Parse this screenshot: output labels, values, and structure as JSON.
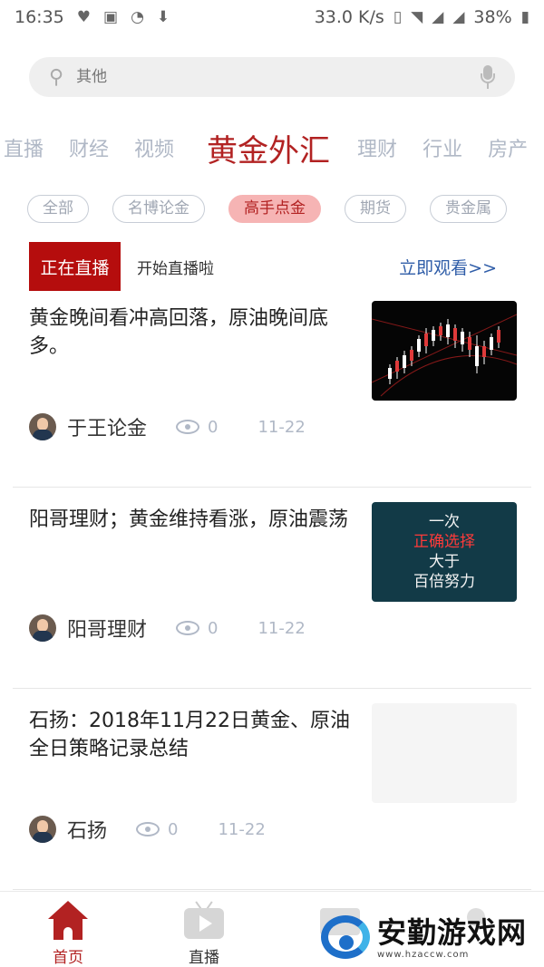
{
  "status_bar": {
    "time": "16:35",
    "speed": "33.0 K/s",
    "battery": "38%"
  },
  "search": {
    "placeholder": "其他"
  },
  "channels": [
    {
      "label": "直播",
      "active": false
    },
    {
      "label": "财经",
      "active": false
    },
    {
      "label": "视频",
      "active": false
    },
    {
      "label": "黄金外汇",
      "active": true
    },
    {
      "label": "理财",
      "active": false
    },
    {
      "label": "行业",
      "active": false
    },
    {
      "label": "房产",
      "active": false
    }
  ],
  "sub_tabs": [
    {
      "label": "全部",
      "active": false
    },
    {
      "label": "名博论金",
      "active": false
    },
    {
      "label": "高手点金",
      "active": true
    },
    {
      "label": "期货",
      "active": false
    },
    {
      "label": "贵金属",
      "active": false
    }
  ],
  "live": {
    "badge": "正在直播",
    "description": "开始直播啦",
    "action": "立即观看>>"
  },
  "articles": [
    {
      "title": "黄金晚间看冲高回落，原油晚间底多。",
      "author": "于王论金",
      "views": "0",
      "date": "11-22",
      "thumb_type": "chart"
    },
    {
      "title": "阳哥理财；黄金维持看涨，原油震荡",
      "author": "阳哥理财",
      "views": "0",
      "date": "11-22",
      "thumb_type": "text",
      "thumb_lines": [
        "一次",
        "正确选择",
        "大于",
        "百倍努力"
      ]
    },
    {
      "title": "石扬：2018年11月22日黄金、原油全日策略记录总结",
      "author": "石扬",
      "views": "0",
      "date": "11-22",
      "thumb_type": "empty"
    }
  ],
  "bottom_nav": [
    {
      "label": "首页",
      "icon": "home-icon",
      "active": true
    },
    {
      "label": "直播",
      "icon": "tv-icon",
      "active": false
    },
    {
      "label": "",
      "icon": "card-icon",
      "active": false
    },
    {
      "label": "",
      "icon": "user-icon",
      "active": false
    }
  ],
  "watermark": {
    "cn": "安勤游戏网",
    "url": "www.hzaccw.com"
  },
  "colors": {
    "accent": "#b22222",
    "link": "#2f5da8",
    "live_badge": "#b50d0d"
  }
}
